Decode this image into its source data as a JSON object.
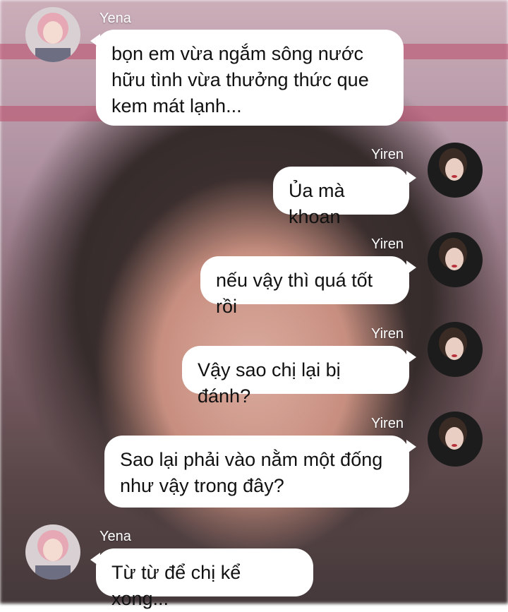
{
  "messages": [
    {
      "sender": "Yena",
      "text": "bọn em vừa ngắm sông nước hữu tình vừa thưởng thức que kem mát lạnh..."
    },
    {
      "sender": "Yiren",
      "text": "Ủa mà khoan"
    },
    {
      "sender": "Yiren",
      "text": "nếu vậy thì quá tốt rồi"
    },
    {
      "sender": "Yiren",
      "text": "Vậy sao chị lại bị đánh?"
    },
    {
      "sender": "Yiren",
      "text": "Sao lại phải vào nằm một đống như vậy trong đây?"
    },
    {
      "sender": "Yena",
      "text": "Từ từ để chị kể xong..."
    }
  ],
  "avatars": {
    "yena": "avatar-yena",
    "yiren": "avatar-yiren"
  },
  "colors": {
    "bubble": "#ffffff",
    "name_text": "#ffffff",
    "message_text": "#111111"
  }
}
